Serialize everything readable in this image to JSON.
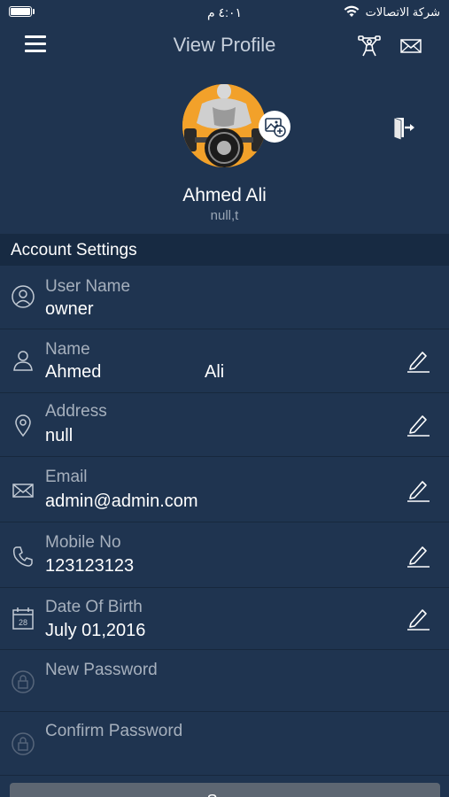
{
  "status_bar": {
    "time": "٤:٠١ م",
    "carrier": "شركة الاتصالات"
  },
  "nav": {
    "title": "View Profile",
    "icons": [
      "menu-icon",
      "fitness-icon",
      "mail-icon"
    ]
  },
  "profile": {
    "name": "Ahmed Ali",
    "subtitle": "null,t",
    "avatar_icon": "bodybuilder-avatar",
    "add_photo_icon": "add-photo-icon",
    "logout_icon": "logout-icon"
  },
  "account_settings": {
    "header": "Account Settings",
    "username": {
      "label": "User Name",
      "value": "owner",
      "icon": "user-circle-icon"
    },
    "name": {
      "label": "Name",
      "first": "Ahmed",
      "last": "Ali",
      "icon": "person-icon"
    },
    "address": {
      "label": "Address",
      "value": "null",
      "icon": "location-pin-icon"
    },
    "email": {
      "label": "Email",
      "value": "admin@admin.com",
      "icon": "envelope-icon"
    },
    "mobile": {
      "label": "Mobile No",
      "value": "123123123",
      "icon": "phone-icon"
    },
    "dob": {
      "label": "Date Of Birth",
      "value": "July 01,2016",
      "icon": "calendar-icon",
      "calendar_day": "28"
    },
    "new_password": {
      "label": "New Password",
      "icon": "lock-icon"
    },
    "confirm_password": {
      "label": "Confirm Password",
      "icon": "lock-icon"
    }
  },
  "save_button": {
    "label": "Save"
  },
  "colors": {
    "background": "#1f3450",
    "section_header": "#172a42",
    "label": "#a6b0bd",
    "avatar_accent": "#f2a12a"
  }
}
